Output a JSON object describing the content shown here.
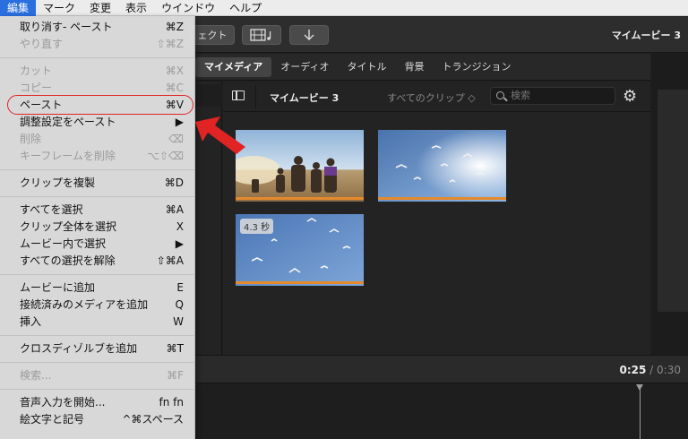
{
  "menubar": {
    "items": [
      "編集",
      "マーク",
      "変更",
      "表示",
      "ウインドウ",
      "ヘルプ"
    ],
    "active_index": 0
  },
  "toolbar": {
    "button1_label": "ェクト",
    "project_title": "マイムービー 3"
  },
  "tabs": [
    "マイメディア",
    "オーディオ",
    "タイトル",
    "背景",
    "トランジション"
  ],
  "browser": {
    "title": "マイムービー 3",
    "filter": "すべてのクリップ ◇",
    "search_placeholder": "検索"
  },
  "clips": [
    {
      "duration": ""
    },
    {
      "duration": ""
    },
    {
      "duration": "4.3 秒"
    }
  ],
  "timeline": {
    "current": "0:25",
    "separator": "/",
    "total": "0:30"
  },
  "edit_menu": {
    "items": [
      {
        "label": "取り消す- ペースト",
        "shortcut": "⌘Z",
        "disabled": false
      },
      {
        "label": "やり直す",
        "shortcut": "⇧⌘Z",
        "disabled": true
      },
      {
        "sep": true
      },
      {
        "label": "カット",
        "shortcut": "⌘X",
        "disabled": true
      },
      {
        "label": "コピー",
        "shortcut": "⌘C",
        "disabled": true
      },
      {
        "label": "ペースト",
        "shortcut": "⌘V",
        "disabled": false,
        "highlighted": true
      },
      {
        "label": "調整設定をペースト",
        "shortcut": "▶",
        "disabled": false
      },
      {
        "label": "削除",
        "shortcut": "⌫",
        "disabled": true
      },
      {
        "label": "キーフレームを削除",
        "shortcut": "⌥⇧⌫",
        "disabled": true
      },
      {
        "sep": true
      },
      {
        "label": "クリップを複製",
        "shortcut": "⌘D",
        "disabled": false
      },
      {
        "sep": true
      },
      {
        "label": "すべてを選択",
        "shortcut": "⌘A",
        "disabled": false
      },
      {
        "label": "クリップ全体を選択",
        "shortcut": "X",
        "disabled": false
      },
      {
        "label": "ムービー内で選択",
        "shortcut": "▶",
        "disabled": false
      },
      {
        "label": "すべての選択を解除",
        "shortcut": "⇧⌘A",
        "disabled": false
      },
      {
        "sep": true
      },
      {
        "label": "ムービーに追加",
        "shortcut": "E",
        "disabled": false
      },
      {
        "label": "接続済みのメディアを追加",
        "shortcut": "Q",
        "disabled": false
      },
      {
        "label": "挿入",
        "shortcut": "W",
        "disabled": false
      },
      {
        "sep": true
      },
      {
        "label": "クロスディゾルブを追加",
        "shortcut": "⌘T",
        "disabled": false
      },
      {
        "sep": true
      },
      {
        "label": "検索...",
        "shortcut": "⌘F",
        "disabled": true
      },
      {
        "sep": true
      },
      {
        "label": "音声入力を開始...",
        "shortcut": "fn fn",
        "disabled": false
      },
      {
        "label": "絵文字と記号",
        "shortcut": "^⌘スペース",
        "disabled": false
      }
    ]
  },
  "colors": {
    "menubar_active": "#2a6fe0",
    "highlight_ring": "#e02424",
    "arrow": "#e02424",
    "clip_bar": "#e48a2c"
  }
}
